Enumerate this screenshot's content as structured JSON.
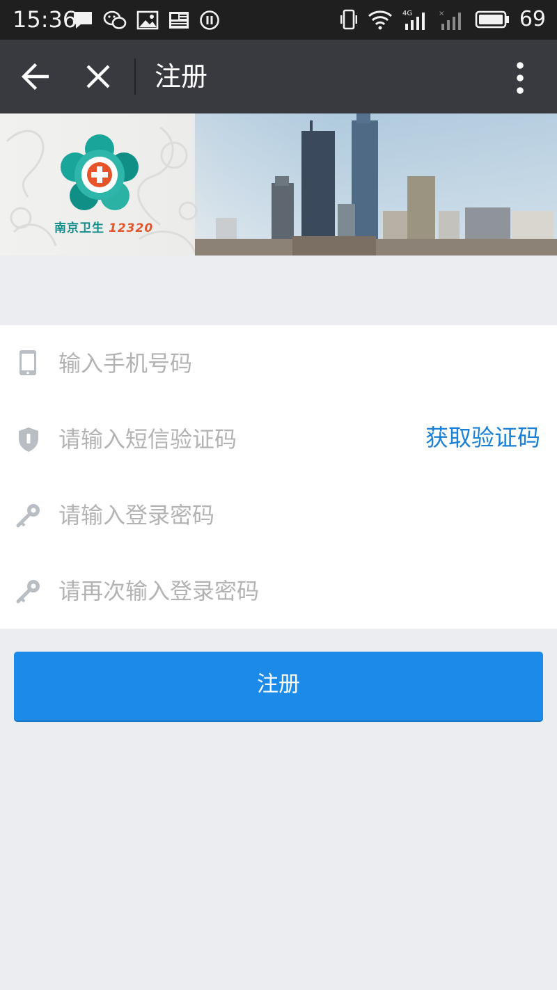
{
  "status_bar": {
    "time": "15:36",
    "battery_percent": "69",
    "network": "4G",
    "icons_left": [
      "message-icon",
      "wechat-icon",
      "image-icon",
      "news-icon",
      "pause-icon"
    ],
    "icons_right": [
      "vibrate-icon",
      "wifi-icon",
      "signal-4g-icon",
      "signal-icon",
      "battery-icon"
    ]
  },
  "navbar": {
    "title": "注册",
    "back_icon": "arrow-left-icon",
    "close_icon": "close-icon",
    "more_icon": "more-vertical-icon"
  },
  "banner": {
    "logo_name": "南京卫生",
    "logo_number": "12320"
  },
  "form": {
    "phone_placeholder": "输入手机号码",
    "sms_code_placeholder": "请输入短信验证码",
    "get_code_label": "获取验证码",
    "password_placeholder": "请输入登录密码",
    "confirm_password_placeholder": "请再次输入登录密码"
  },
  "register_button": "注册",
  "colors": {
    "accent": "#1c8ae8",
    "link": "#1a7fd6",
    "navbar": "#393a3f",
    "statusbar": "#1f1f1f",
    "page_bg": "#ebedf0"
  }
}
